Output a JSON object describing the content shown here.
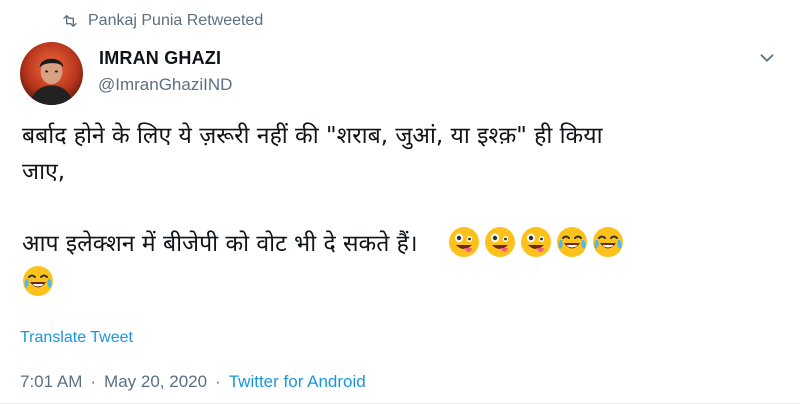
{
  "retweet": {
    "label": "Pankaj Punia Retweeted",
    "icon": "retweet-icon"
  },
  "author": {
    "name": "IMRAN GHAZI",
    "handle": "@ImranGhaziIND",
    "avatar_icon": "avatar-image"
  },
  "menu": {
    "icon": "chevron-down-icon"
  },
  "body": {
    "line1": "बर्बाद होने के लिए ये ज़रूरी नहीं की \"शराब, जुआं, या इश्क़\" ही किया",
    "line2": "जाए,",
    "line3": "आप इलेक्शन में बीजेपी को वोट भी दे सकते हैं।",
    "emojis_line3": [
      "zany-face",
      "zany-face",
      "zany-face",
      "tears-of-joy",
      "tears-of-joy"
    ],
    "emojis_line4": [
      "tears-of-joy"
    ]
  },
  "translate_label": "Translate Tweet",
  "meta": {
    "time": "7:01 AM",
    "separator": "·",
    "date": "May 20, 2020",
    "source": "Twitter for Android"
  },
  "colors": {
    "link": "#1b95e0",
    "muted": "#5b7083",
    "text": "#0f1419"
  }
}
